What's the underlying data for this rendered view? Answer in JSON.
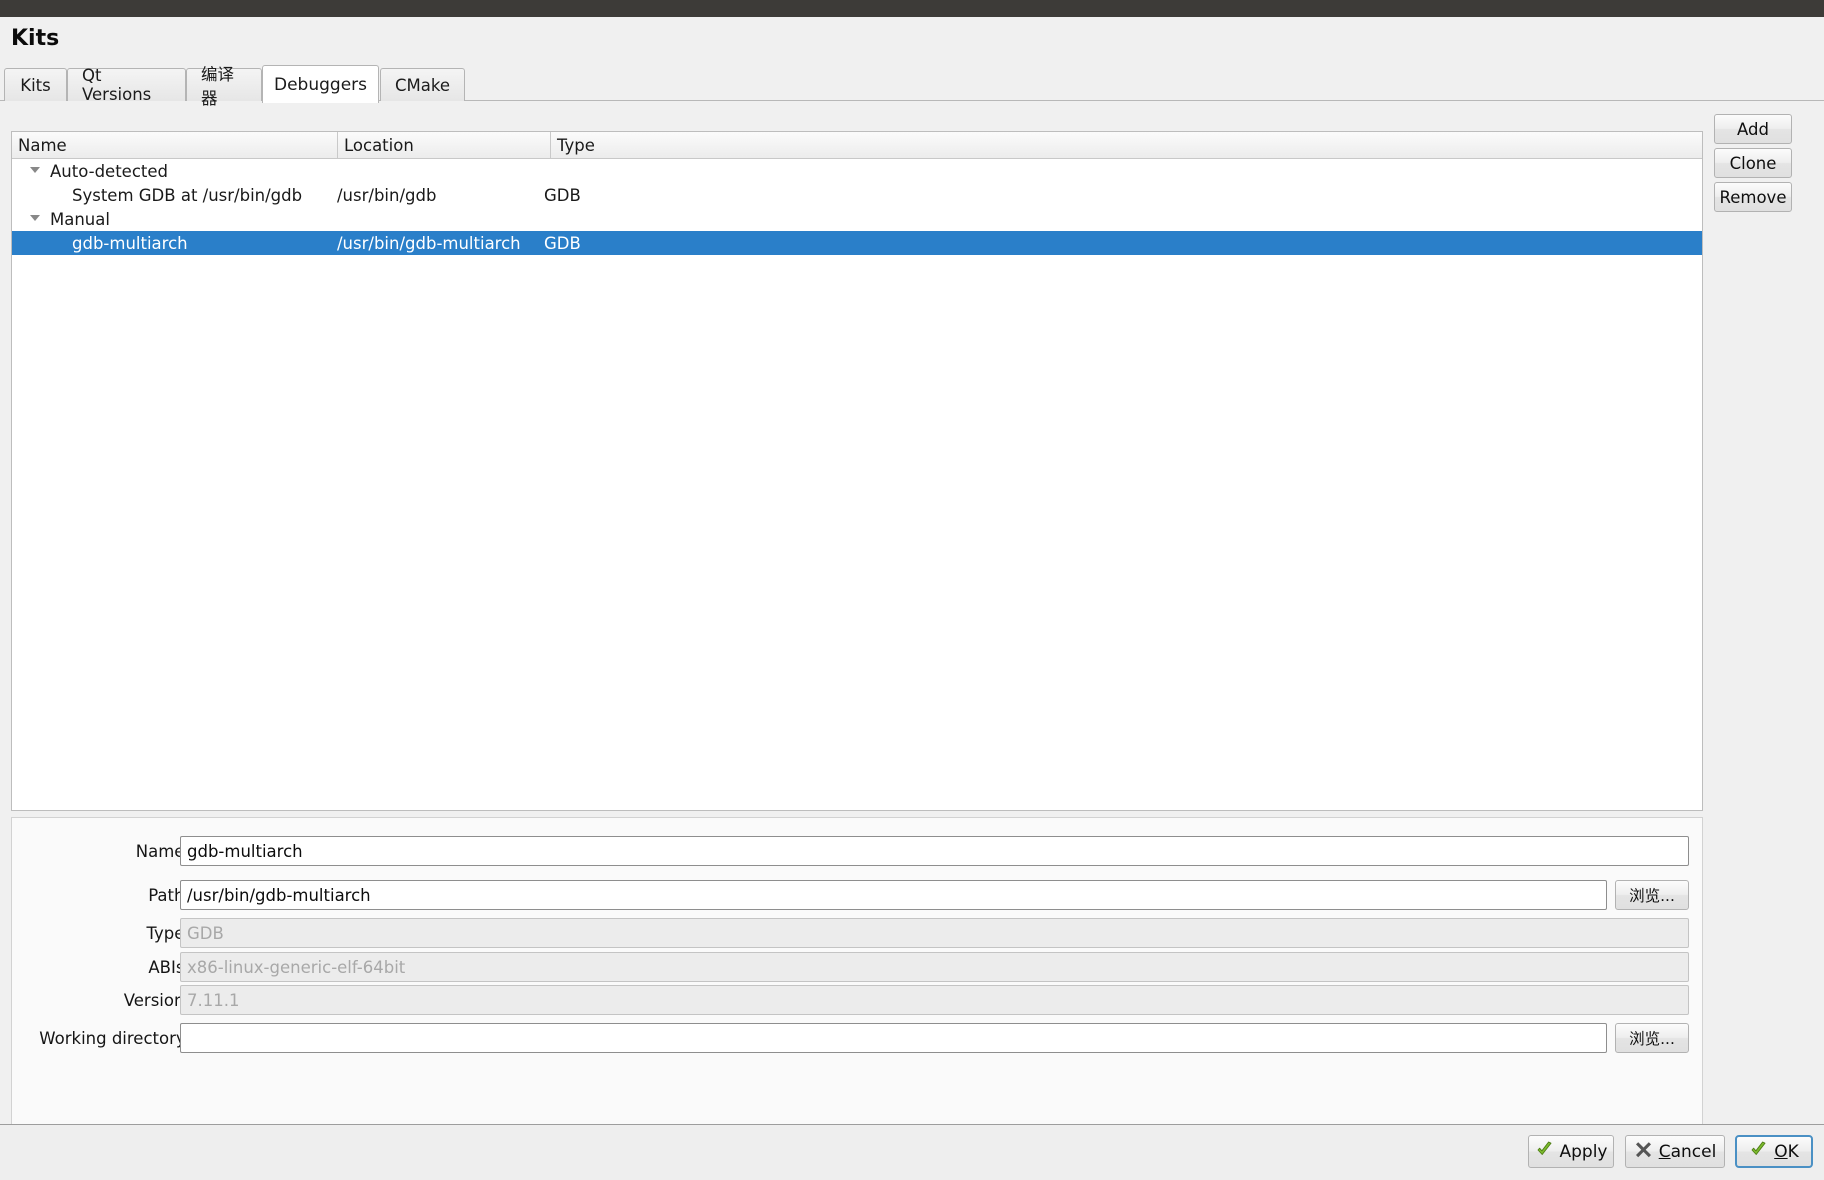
{
  "window": {
    "title": "Kits"
  },
  "tabs": [
    {
      "label": "Kits",
      "selected": false
    },
    {
      "label": "Qt Versions",
      "selected": false
    },
    {
      "label": "编译器",
      "selected": false
    },
    {
      "label": "Debuggers",
      "selected": true
    },
    {
      "label": "CMake",
      "selected": false
    }
  ],
  "tree": {
    "columns": [
      "Name",
      "Location",
      "Type"
    ],
    "rows": [
      {
        "name": "Auto-detected",
        "location": "",
        "type": "",
        "group": true,
        "indent": 0,
        "expanded": true,
        "selected": false
      },
      {
        "name": "System GDB at /usr/bin/gdb",
        "location": "/usr/bin/gdb",
        "type": "GDB",
        "group": false,
        "indent": 1,
        "expanded": false,
        "selected": false
      },
      {
        "name": "Manual",
        "location": "",
        "type": "",
        "group": true,
        "indent": 0,
        "expanded": true,
        "selected": false
      },
      {
        "name": "gdb-multiarch",
        "location": "/usr/bin/gdb-multiarch",
        "type": "GDB",
        "group": false,
        "indent": 1,
        "expanded": false,
        "selected": true
      }
    ]
  },
  "side_buttons": [
    {
      "label": "Add"
    },
    {
      "label": "Clone"
    },
    {
      "label": "Remove"
    }
  ],
  "details": {
    "fields": [
      {
        "label": "Name:",
        "value": "gdb-multiarch",
        "placeholder": "",
        "readonly": false,
        "browse": false
      },
      {
        "label": "Path:",
        "value": "/usr/bin/gdb-multiarch",
        "placeholder": "",
        "readonly": false,
        "browse": true
      },
      {
        "label": "Type:",
        "value": "",
        "placeholder": "GDB",
        "readonly": true,
        "browse": false
      },
      {
        "label": "ABIs:",
        "value": "",
        "placeholder": "x86-linux-generic-elf-64bit",
        "readonly": true,
        "browse": false
      },
      {
        "label": "Version:",
        "value": "",
        "placeholder": "7.11.1",
        "readonly": true,
        "browse": false
      },
      {
        "label": "Working directory:",
        "value": "",
        "placeholder": "",
        "readonly": false,
        "browse": true
      }
    ],
    "browse_label": "浏览..."
  },
  "dialog_buttons": [
    {
      "label": "Apply",
      "accel": "",
      "icon": "check-icon",
      "focused": false
    },
    {
      "label": "Cancel",
      "accel": "C",
      "icon": "cross-icon",
      "focused": false
    },
    {
      "label": "OK",
      "accel": "O",
      "icon": "check-icon",
      "focused": true
    }
  ],
  "colors": {
    "selection": "#2a7fc9",
    "accent_focus": "#4a90c4",
    "check_green": "#7dbb2e",
    "cross_gray": "#555555",
    "titlebar": "#3d3b38"
  }
}
